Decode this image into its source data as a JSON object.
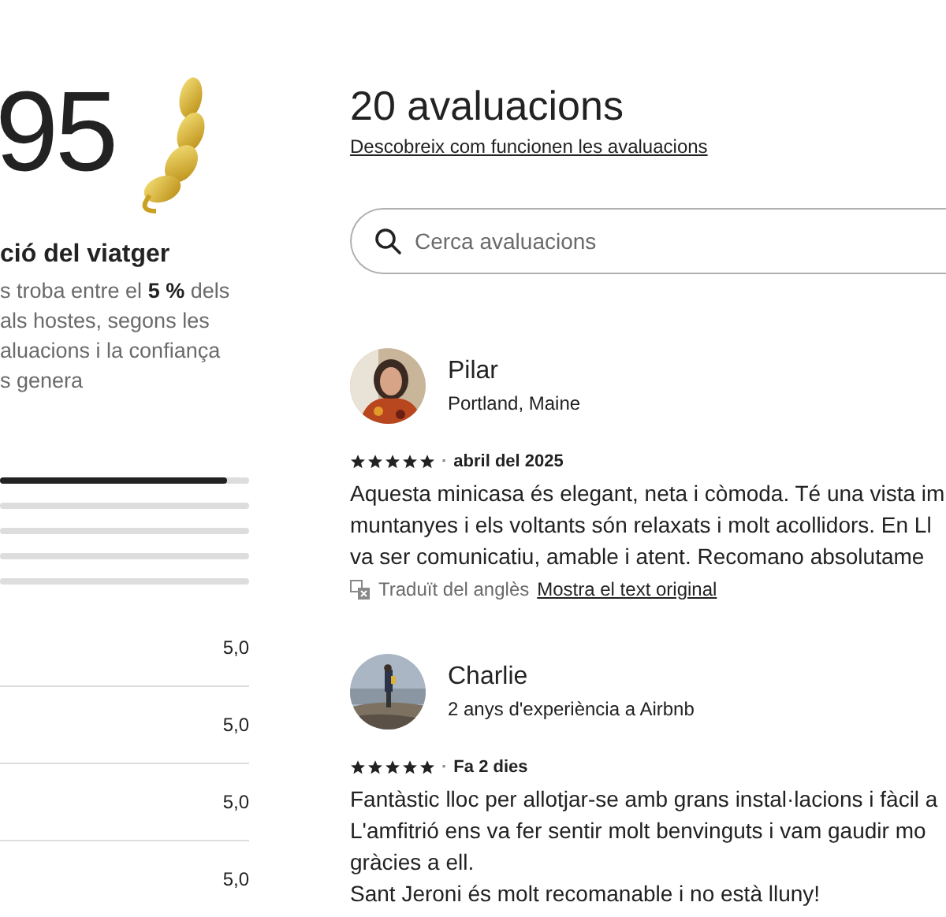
{
  "summary": {
    "score": "95",
    "title": "ció del viatger",
    "description_lines": [
      "s troba entre el **5 %** dels",
      "als hostes, segons les",
      "aluacions i la confiança",
      "s genera"
    ]
  },
  "rating_bars": [
    {
      "level": 0.91
    },
    {
      "level": 0
    },
    {
      "level": 0
    },
    {
      "level": 0
    },
    {
      "level": 0
    }
  ],
  "categories": [
    {
      "value": "5,0"
    },
    {
      "value": "5,0"
    },
    {
      "value": "5,0"
    },
    {
      "value": "5,0"
    }
  ],
  "reviews_header": {
    "title": "20 avaluacions",
    "link": "Descobreix com funcionen les avaluacions"
  },
  "search": {
    "placeholder": "Cerca avaluacions"
  },
  "reviews": [
    {
      "name": "Pilar",
      "subtitle": "Portland, Maine",
      "stars": 5,
      "separator": "·",
      "date": "abril del 2025",
      "lines": [
        "Aquesta minicasa és elegant, neta i còmoda. Té una vista im",
        "muntanyes i els voltants són relaxats i molt acollidors. En Ll",
        "va ser comunicatiu, amable i atent. Recomano absolutame"
      ],
      "translation": {
        "note": "Traduït del anglès",
        "link": "Mostra el text original"
      }
    },
    {
      "name": "Charlie",
      "subtitle": "2 anys d'experiència a Airbnb",
      "stars": 5,
      "separator": "·",
      "date": "Fa 2 dies",
      "lines": [
        "Fantàstic lloc per allotjar-se amb grans instal·lacions i fàcil a",
        "L'amfitrió ens va fer sentir molt benvinguts i vam gaudir mo",
        "gràcies a ell.",
        "Sant Jeroni és molt recomanable i no està lluny!"
      ]
    }
  ]
}
